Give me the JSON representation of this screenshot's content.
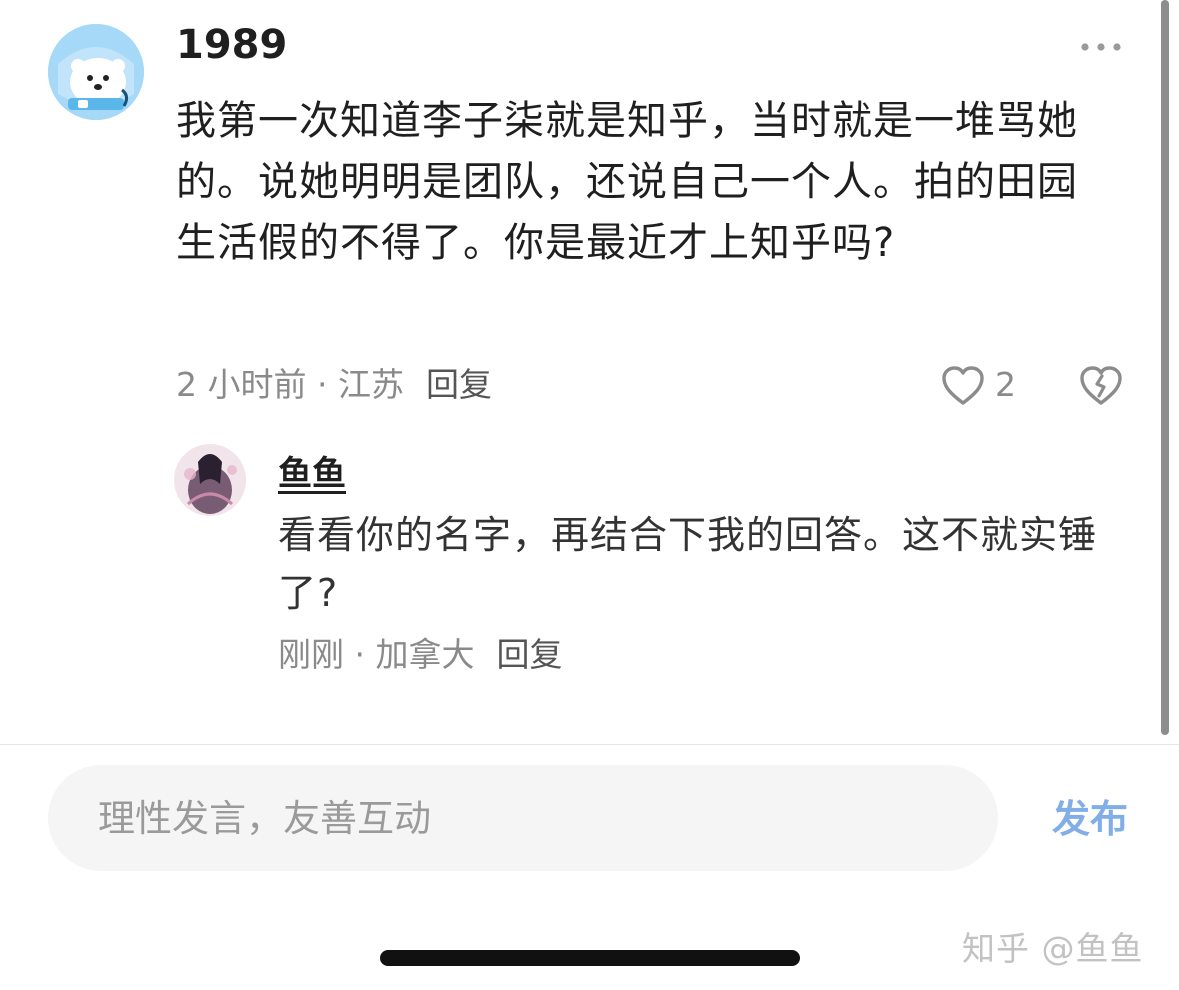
{
  "comment": {
    "username": "1989",
    "text": "我第一次知道李子柒就是知乎，当时就是一堆骂她的。说她明明是团队，还说自己一个人。拍的田园生活假的不得了。你是最近才上知乎吗?",
    "time": "2 小时前",
    "separator": " · ",
    "location": "江苏",
    "reply_label": "回复",
    "like_count": "2"
  },
  "reply": {
    "username": "鱼鱼",
    "text": "看看你的名字，再结合下我的回答。这不就实锤了?",
    "time": "刚刚",
    "separator": " · ",
    "location": "加拿大",
    "reply_label": "回复"
  },
  "input_bar": {
    "placeholder": "理性发言，友善互动",
    "publish_label": "发布"
  },
  "watermark": "知乎 @鱼鱼",
  "colors": {
    "publish_accent": "#82aee8",
    "meta_gray": "#8a8a8a",
    "avatar_blue": "#9fd4f6"
  }
}
